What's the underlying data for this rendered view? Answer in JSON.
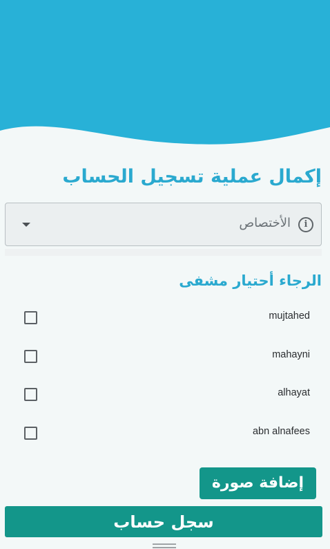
{
  "colors": {
    "header_wave": "#28b1d7",
    "accent_text": "#2aa9cf",
    "button": "#13968a",
    "background": "#f3f8f8"
  },
  "form": {
    "title": "إكمال عملية تسجيل الحساب",
    "specialty": {
      "value": "الأختصاص",
      "icon": "info-icon"
    },
    "hospitals_heading": "الرجاء أحتيار مشفى",
    "hospitals": [
      {
        "label": "mujtahed",
        "checked": false
      },
      {
        "label": "mahayni",
        "checked": false
      },
      {
        "label": "alhayat",
        "checked": false
      },
      {
        "label": "abn alnafees",
        "checked": false
      }
    ],
    "add_photo_label": "إضافة صورة",
    "register_label": "سجل حساب"
  }
}
